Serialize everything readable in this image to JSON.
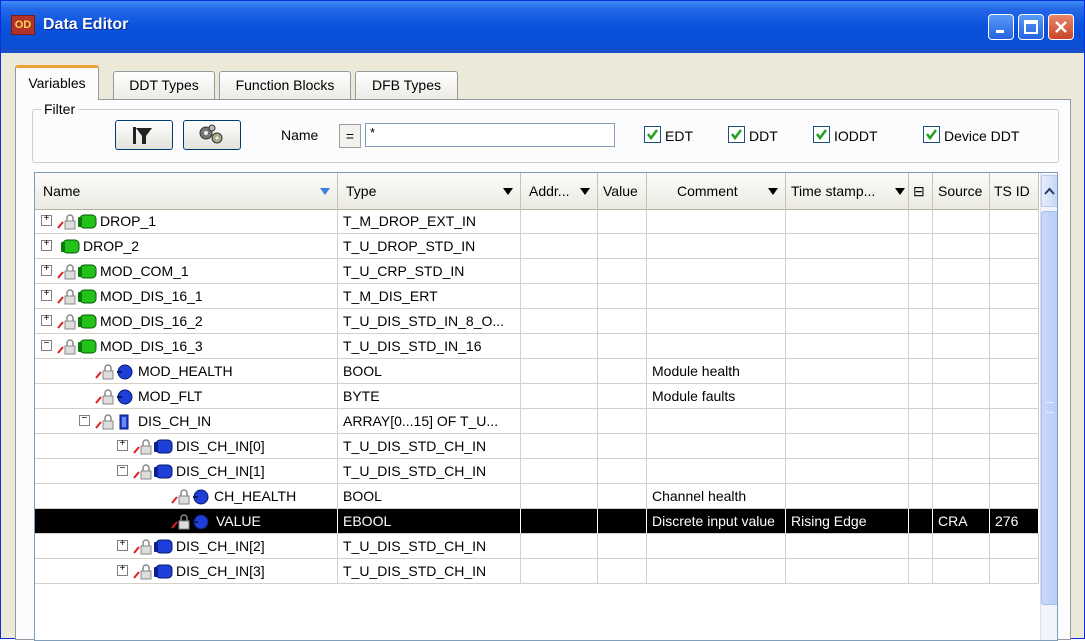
{
  "window": {
    "title": "Data Editor",
    "icon_text": "OD"
  },
  "tabs": [
    {
      "label": "Variables",
      "active": true
    },
    {
      "label": "DDT Types",
      "active": false
    },
    {
      "label": "Function Blocks",
      "active": false
    },
    {
      "label": "DFB Types",
      "active": false
    }
  ],
  "filter": {
    "legend": "Filter",
    "name_label": "Name",
    "eq_label": "=",
    "value": "*",
    "checks": [
      {
        "label": "EDT",
        "checked": true
      },
      {
        "label": "DDT",
        "checked": true
      },
      {
        "label": "IODDT",
        "checked": true
      },
      {
        "label": "Device DDT",
        "checked": true
      }
    ]
  },
  "columns": [
    {
      "label": "Name"
    },
    {
      "label": "Type"
    },
    {
      "label": "Addr..."
    },
    {
      "label": "Value"
    },
    {
      "label": "Comment"
    },
    {
      "label": "Time stamp..."
    },
    {
      "label": "⊟"
    },
    {
      "label": "Source"
    },
    {
      "label": "TS ID"
    }
  ],
  "rows": [
    {
      "name": "DROP_1",
      "type": "T_M_DROP_EXT_IN",
      "comment": "",
      "timestamp": "",
      "source": "",
      "tsid": "",
      "level": 0,
      "expander": "+",
      "icon": "green-module",
      "lock": true,
      "selected": false
    },
    {
      "name": "DROP_2",
      "type": "T_U_DROP_STD_IN",
      "comment": "",
      "timestamp": "",
      "source": "",
      "tsid": "",
      "level": 0,
      "expander": "+",
      "icon": "green-module",
      "lock": false,
      "selected": false
    },
    {
      "name": "MOD_COM_1",
      "type": "T_U_CRP_STD_IN",
      "comment": "",
      "timestamp": "",
      "source": "",
      "tsid": "",
      "level": 0,
      "expander": "+",
      "icon": "green-module",
      "lock": true,
      "selected": false
    },
    {
      "name": "MOD_DIS_16_1",
      "type": "T_M_DIS_ERT",
      "comment": "",
      "timestamp": "",
      "source": "",
      "tsid": "",
      "level": 0,
      "expander": "+",
      "icon": "green-module",
      "lock": true,
      "selected": false
    },
    {
      "name": "MOD_DIS_16_2",
      "type": "T_U_DIS_STD_IN_8_O...",
      "comment": "",
      "timestamp": "",
      "source": "",
      "tsid": "",
      "level": 0,
      "expander": "+",
      "icon": "green-module",
      "lock": true,
      "selected": false
    },
    {
      "name": "MOD_DIS_16_3",
      "type": "T_U_DIS_STD_IN_16",
      "comment": "",
      "timestamp": "",
      "source": "",
      "tsid": "",
      "level": 0,
      "expander": "-",
      "icon": "green-module",
      "lock": true,
      "selected": false
    },
    {
      "name": "MOD_HEALTH",
      "type": "BOOL",
      "comment": "Module health",
      "timestamp": "",
      "source": "",
      "tsid": "",
      "level": 1,
      "expander": "",
      "icon": "blue-dot",
      "lock": true,
      "selected": false
    },
    {
      "name": "MOD_FLT",
      "type": "BYTE",
      "comment": "Module faults",
      "timestamp": "",
      "source": "",
      "tsid": "",
      "level": 1,
      "expander": "",
      "icon": "blue-dot",
      "lock": true,
      "selected": false
    },
    {
      "name": "DIS_CH_IN",
      "type": "ARRAY[0...15] OF T_U...",
      "comment": "",
      "timestamp": "",
      "source": "",
      "tsid": "",
      "level": 1,
      "expander": "-",
      "icon": "blue-array",
      "lock": true,
      "selected": false
    },
    {
      "name": "DIS_CH_IN[0]",
      "type": "T_U_DIS_STD_CH_IN",
      "comment": "",
      "timestamp": "",
      "source": "",
      "tsid": "",
      "level": 2,
      "expander": "+",
      "icon": "blue-module",
      "lock": true,
      "selected": false
    },
    {
      "name": "DIS_CH_IN[1]",
      "type": "T_U_DIS_STD_CH_IN",
      "comment": "",
      "timestamp": "",
      "source": "",
      "tsid": "",
      "level": 2,
      "expander": "-",
      "icon": "blue-module",
      "lock": true,
      "selected": false
    },
    {
      "name": "CH_HEALTH",
      "type": "BOOL",
      "comment": "Channel health",
      "timestamp": "",
      "source": "",
      "tsid": "",
      "level": 3,
      "expander": "",
      "icon": "blue-dot",
      "lock": true,
      "selected": false
    },
    {
      "name": "VALUE",
      "type": "EBOOL",
      "comment": "Discrete input value",
      "timestamp": "Rising Edge",
      "source": "CRA",
      "tsid": "276",
      "level": 3,
      "expander": "",
      "icon": "blue-dot",
      "lock": true,
      "selected": true
    },
    {
      "name": "DIS_CH_IN[2]",
      "type": "T_U_DIS_STD_CH_IN",
      "comment": "",
      "timestamp": "",
      "source": "",
      "tsid": "",
      "level": 2,
      "expander": "+",
      "icon": "blue-module",
      "lock": true,
      "selected": false
    },
    {
      "name": "DIS_CH_IN[3]",
      "type": "T_U_DIS_STD_CH_IN",
      "comment": "",
      "timestamp": "",
      "source": "",
      "tsid": "",
      "level": 2,
      "expander": "+",
      "icon": "blue-module",
      "lock": true,
      "selected": false
    }
  ],
  "colors": {
    "title_bar": "#0a52dd",
    "selected_row": "#000000",
    "active_tab_accent": "#e8a238",
    "checkbox_check": "#21a121"
  }
}
